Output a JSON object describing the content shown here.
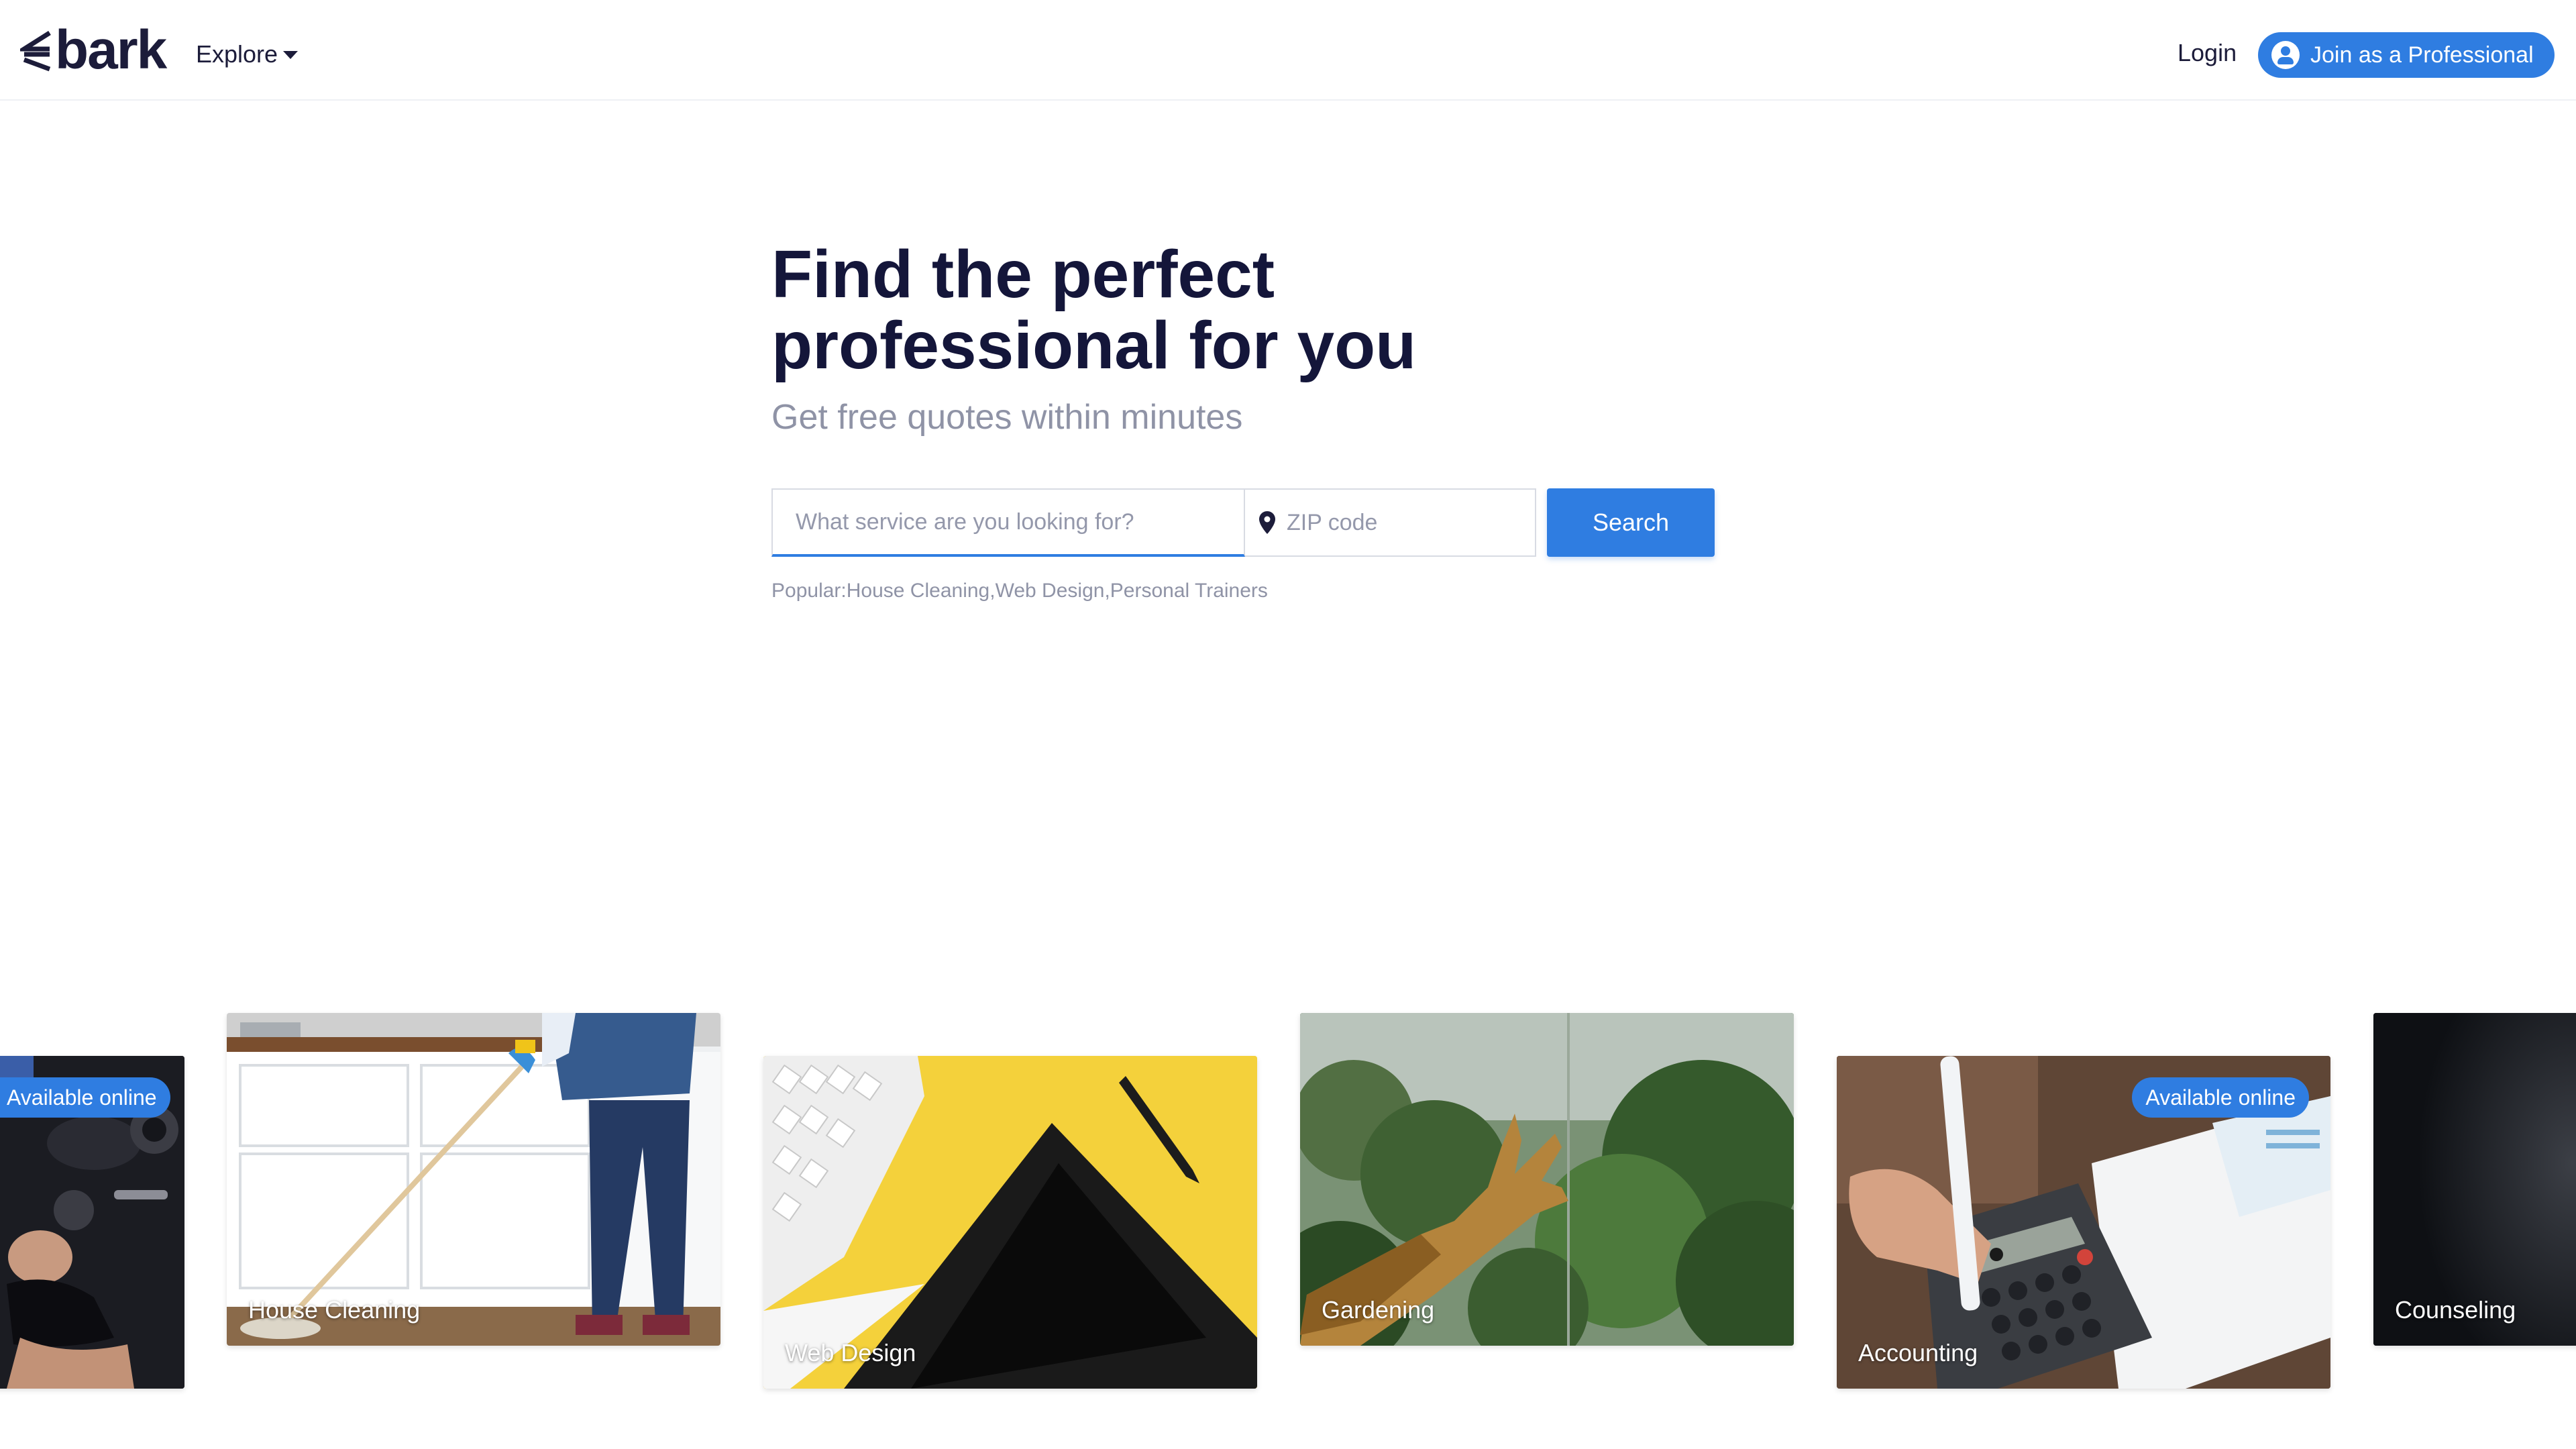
{
  "header": {
    "logo_text": "bark",
    "explore_label": "Explore",
    "login_label": "Login",
    "join_label": "Join as a Professional"
  },
  "hero": {
    "title_line1": "Find the perfect",
    "title_line2": "professional for you",
    "subtitle": "Get free quotes within minutes"
  },
  "search": {
    "service_placeholder": "What service are you looking for?",
    "service_value": "",
    "zip_placeholder": "ZIP code",
    "zip_value": "",
    "button_label": "Search"
  },
  "popular": {
    "prefix": "Popular: ",
    "items": [
      "House Cleaning",
      "Web Design",
      "Personal Trainers"
    ],
    "separator": ", "
  },
  "cards": [
    {
      "label": "",
      "badge": "Available online",
      "icon": "fitness-photo"
    },
    {
      "label": "House Cleaning",
      "badge": "",
      "icon": "cleaning-photo"
    },
    {
      "label": "Web Design",
      "badge": "",
      "icon": "web-design-photo"
    },
    {
      "label": "Gardening",
      "badge": "",
      "icon": "gardening-photo"
    },
    {
      "label": "Accounting",
      "badge": "Available online",
      "icon": "accounting-photo"
    },
    {
      "label": "Counseling",
      "badge": "",
      "icon": "counseling-photo"
    }
  ],
  "colors": {
    "accent": "#2f7de1",
    "title": "#14163a",
    "muted": "#8f93a6",
    "border": "#d8dbe3"
  }
}
